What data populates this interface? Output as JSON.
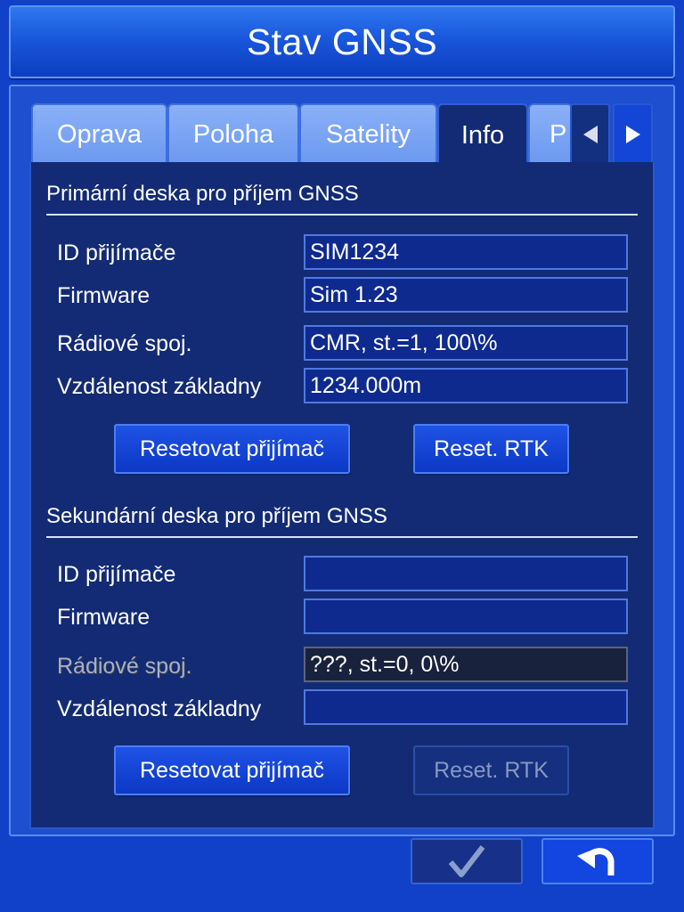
{
  "title": "Stav GNSS",
  "tabs": [
    {
      "label": "Oprava"
    },
    {
      "label": "Poloha"
    },
    {
      "label": "Satelity"
    },
    {
      "label": "Info",
      "active": true
    },
    {
      "label": "P"
    }
  ],
  "primary": {
    "heading": "Primární deska pro příjem GNSS",
    "receiver_id_label": "ID přijímače",
    "receiver_id_value": "SIM1234",
    "firmware_label": "Firmware",
    "firmware_value": "Sim 1.23",
    "radio_label": "Rádiové spoj.",
    "radio_value": "CMR, st.=1, 100\\%",
    "distance_label": "Vzdálenost základny",
    "distance_value": "1234.000m",
    "reset_receiver_label": "Resetovat přijímač",
    "reset_rtk_label": "Reset. RTK"
  },
  "secondary": {
    "heading": "Sekundární deska pro příjem GNSS",
    "receiver_id_label": "ID přijímače",
    "receiver_id_value": "",
    "firmware_label": "Firmware",
    "firmware_value": "",
    "radio_label": "Rádiové spoj.",
    "radio_value": "???, st.=0, 0\\%",
    "distance_label": "Vzdálenost základny",
    "distance_value": "",
    "reset_receiver_label": "Resetovat přijímač",
    "reset_rtk_label": "Reset. RTK"
  },
  "icons": {
    "tab_prev": "triangle-left-icon",
    "tab_next": "triangle-right-icon",
    "confirm": "checkmark-icon",
    "back": "undo-arrow-icon"
  },
  "colors": {
    "background": "#1141c8",
    "panel": "#132b74",
    "tab_inactive": "#7aa4f4",
    "button": "#1546d8"
  }
}
